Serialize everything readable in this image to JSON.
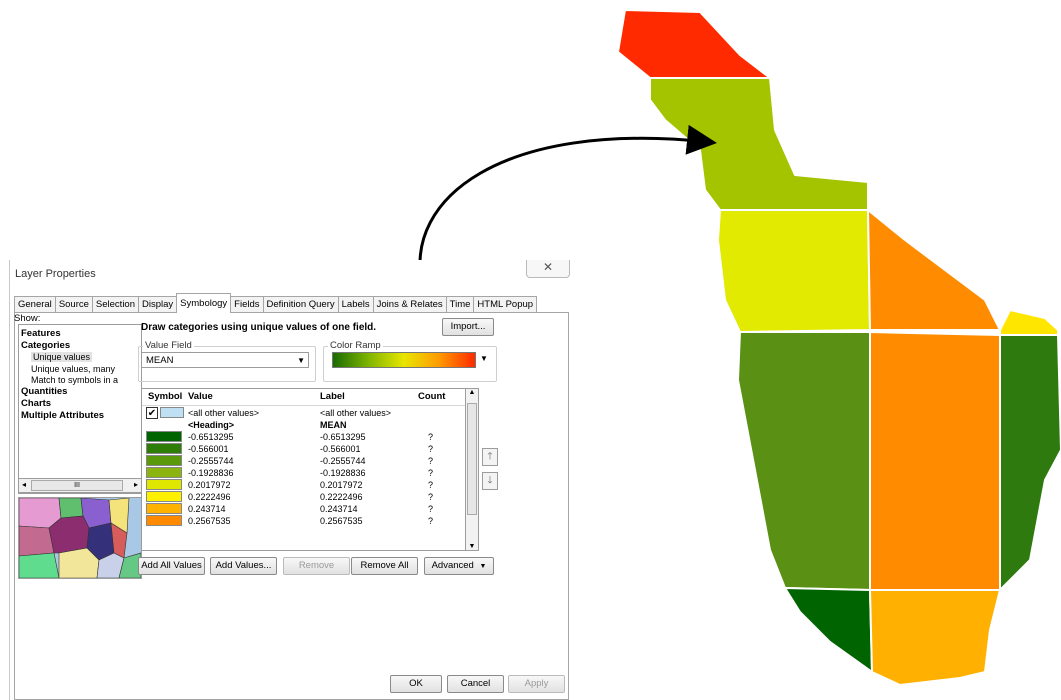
{
  "dialog": {
    "title": "Layer Properties",
    "close_label": "✕",
    "tabs": [
      "General",
      "Source",
      "Selection",
      "Display",
      "Symbology",
      "Fields",
      "Definition Query",
      "Labels",
      "Joins & Relates",
      "Time",
      "HTML Popup"
    ],
    "active_tab": "Symbology",
    "show_label": "Show:",
    "show_tree": {
      "features": "Features",
      "categories": "Categories",
      "unique_values": "Unique values",
      "unique_values_many": "Unique values, many",
      "match_symbols": "Match to symbols in a",
      "quantities": "Quantities",
      "charts": "Charts",
      "multiple_attributes": "Multiple Attributes",
      "scroll_thumb": "III"
    },
    "draw_label": "Draw categories using unique values of one field.",
    "import_label": "Import...",
    "value_field": {
      "legend": "Value Field",
      "value": "MEAN"
    },
    "color_ramp": {
      "legend": "Color Ramp",
      "colors": [
        "#1a6b00",
        "#7fb400",
        "#e8e600",
        "#ff9900",
        "#ff2a00"
      ]
    },
    "table": {
      "headers": {
        "symbol": "Symbol",
        "value": "Value",
        "label": "Label",
        "count": "Count"
      },
      "all_other": {
        "value": "<all other values>",
        "label": "<all other values>",
        "checked": true,
        "color": "#bfe0f2"
      },
      "heading": {
        "value": "<Heading>",
        "label": "MEAN"
      },
      "rows": [
        {
          "color": "#006400",
          "value": "-0.6513295",
          "label": "-0.6513295",
          "count": "?"
        },
        {
          "color": "#2e7d07",
          "value": "-0.566001",
          "label": "-0.566001",
          "count": "?"
        },
        {
          "color": "#5a9a0a",
          "value": "-0.2555744",
          "label": "-0.2555744",
          "count": "?"
        },
        {
          "color": "#8cb410",
          "value": "-0.1928836",
          "label": "-0.1928836",
          "count": "?"
        },
        {
          "color": "#dfe600",
          "value": "0.2017972",
          "label": "0.2017972",
          "count": "?"
        },
        {
          "color": "#fff000",
          "value": "0.2222496",
          "label": "0.2222496",
          "count": "?"
        },
        {
          "color": "#ffb300",
          "value": "0.243714",
          "label": "0.243714",
          "count": "?"
        },
        {
          "color": "#ff8a00",
          "value": "0.2567535",
          "label": "0.2567535",
          "count": "?"
        }
      ]
    },
    "buttons": {
      "add_all_values": "Add All Values",
      "add_values": "Add Values...",
      "remove": "Remove",
      "remove_all": "Remove All",
      "advanced": "Advanced",
      "ok": "OK",
      "cancel": "Cancel",
      "apply": "Apply"
    }
  },
  "map": {
    "colors": {
      "red": "#ff2a00",
      "yellow_green": "#a4c400",
      "yellow": "#e1ea00",
      "orange": "#ff8c00",
      "bright_yellow": "#ffe600",
      "green": "#5a9114",
      "dark_green": "#2e7a0e",
      "darkest_green": "#006400",
      "amber": "#ffb000"
    }
  }
}
